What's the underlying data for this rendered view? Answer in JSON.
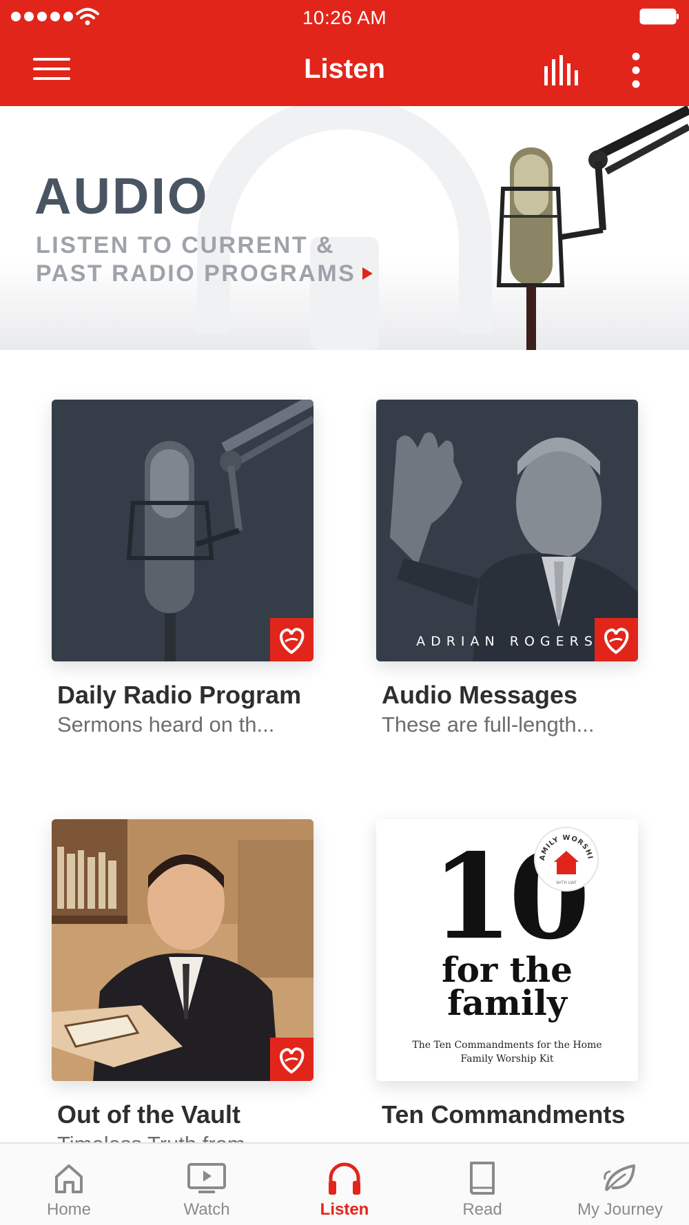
{
  "status_bar": {
    "time": "10:26 AM"
  },
  "header": {
    "title": "Listen",
    "menu_icon": "hamburger-icon",
    "equalizer_icon": "equalizer-icon",
    "more_icon": "more-vertical-icon"
  },
  "banner": {
    "title": "AUDIO",
    "subtitle_line1": "LISTEN TO CURRENT &",
    "subtitle_line2": "PAST RADIO PROGRAMS"
  },
  "cards": [
    {
      "title": "Daily Radio Program",
      "description": "Sermons heard on th..."
    },
    {
      "title": "Audio Messages",
      "description": "These are full-length...",
      "image_caption": "ADRIAN ROGERS"
    },
    {
      "title": "Out of the Vault",
      "description": "Timeless Truth from..."
    },
    {
      "title": "Ten Commandments",
      "description": "",
      "cover": {
        "number": "10",
        "line1": "for the",
        "line2": "family",
        "small1": "The Ten Commandments for the Home",
        "small2": "Family Worship Kit",
        "badge": "FAMILY WORSHIP",
        "badge_sub": "WITH LWF"
      }
    }
  ],
  "tabs": [
    {
      "label": "Home",
      "icon": "home-icon"
    },
    {
      "label": "Watch",
      "icon": "watch-icon"
    },
    {
      "label": "Listen",
      "icon": "headphones-icon",
      "active": true
    },
    {
      "label": "Read",
      "icon": "book-icon"
    },
    {
      "label": "My Journey",
      "icon": "leaf-icon"
    }
  ],
  "colors": {
    "brand": "#e2251b",
    "banner_title": "#4a5563",
    "muted": "#8a8a8a"
  }
}
